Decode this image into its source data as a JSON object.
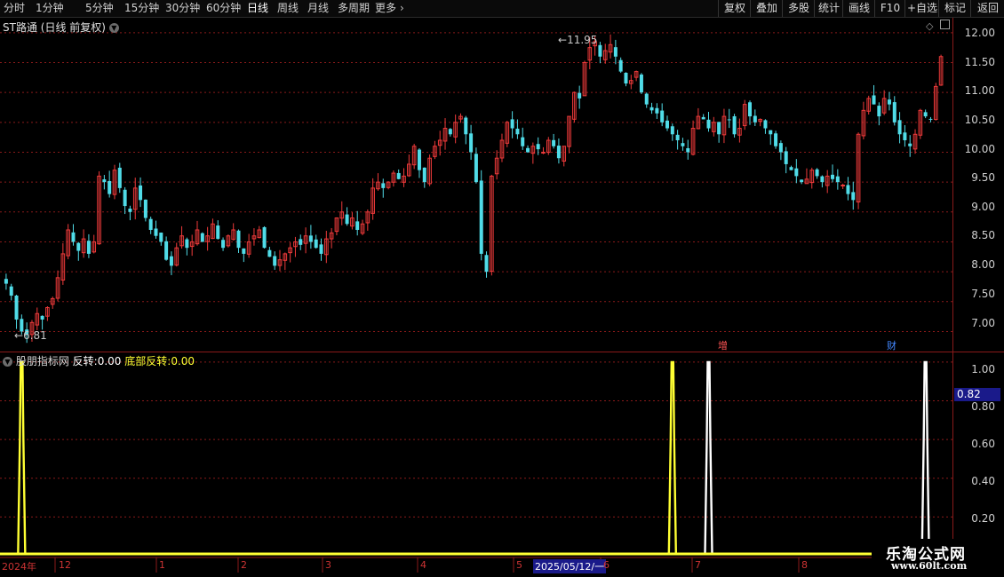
{
  "toolbar": {
    "periods": [
      "分时",
      "1分钟",
      "5分钟",
      "15分钟",
      "30分钟",
      "60分钟",
      "日线",
      "周线",
      "月线",
      "多周期",
      "更多"
    ],
    "active_period": "日线",
    "right_buttons": [
      "复权",
      "叠加",
      "多股",
      "统计",
      "画线",
      "F10",
      "+自选",
      "标记",
      "返回"
    ]
  },
  "main_panel": {
    "stock_title": "ST路通",
    "period_label": "(日线 前复权)",
    "high_label": "11.95",
    "low_label": "6.81",
    "markers": [
      {
        "text": "增",
        "color": "#ff5555"
      },
      {
        "text": "财",
        "color": "#4488ff"
      }
    ],
    "y_axis": [
      "12.00",
      "11.50",
      "11.00",
      "10.50",
      "10.00",
      "9.50",
      "9.00",
      "8.50",
      "8.00",
      "7.50",
      "7.00"
    ]
  },
  "sub_panel": {
    "indicator_name": "股朋指标网",
    "field1_label": "反转:",
    "field1_value": "0.00",
    "field2_label": "底部反转:",
    "field2_value": "0.00",
    "y_axis": [
      "1.00",
      "0.80",
      "0.60",
      "0.40",
      "0.20"
    ],
    "cursor_value": "0.82"
  },
  "date_axis": {
    "labels": [
      "2024年",
      "12",
      "1",
      "2",
      "3",
      "4",
      "5",
      "2025/05/12/一",
      "6",
      "7",
      "8"
    ]
  },
  "watermark": {
    "title": "乐淘公式网",
    "url": "www.60lt.com"
  },
  "colors": {
    "up": "#ee3a3a",
    "down": "#50dce8",
    "grid": "#8a1a1a",
    "signal_yellow": "#ffff33",
    "signal_white": "#ffffff",
    "cursor_box": "#1a1a8a"
  },
  "chart_data": [
    {
      "type": "candlestick",
      "y_axis_ticks": [
        7.0,
        7.5,
        8.0,
        8.5,
        9.0,
        9.5,
        10.0,
        10.5,
        11.0,
        11.5,
        12.0
      ],
      "ylim": [
        6.65,
        12.25
      ],
      "high": 11.95,
      "low": 6.81,
      "closes": [
        7.8,
        7.6,
        7.2,
        7.0,
        6.95,
        7.15,
        7.3,
        7.2,
        7.4,
        7.55,
        7.9,
        8.3,
        8.7,
        8.5,
        8.35,
        8.55,
        8.3,
        8.5,
        9.6,
        9.5,
        9.3,
        9.7,
        9.4,
        9.1,
        9.0,
        9.4,
        9.2,
        8.9,
        8.7,
        8.6,
        8.5,
        8.2,
        8.1,
        8.4,
        8.6,
        8.4,
        8.5,
        8.7,
        8.5,
        8.6,
        8.8,
        8.55,
        8.4,
        8.6,
        8.7,
        8.4,
        8.3,
        8.5,
        8.6,
        8.7,
        8.4,
        8.25,
        8.1,
        8.2,
        8.3,
        8.4,
        8.5,
        8.45,
        8.6,
        8.5,
        8.4,
        8.3,
        8.55,
        8.65,
        8.9,
        9.0,
        8.8,
        8.9,
        8.7,
        8.8,
        9.0,
        9.4,
        9.5,
        9.4,
        9.5,
        9.65,
        9.55,
        9.6,
        9.8,
        10.1,
        9.7,
        9.5,
        9.9,
        10.1,
        10.2,
        10.4,
        10.3,
        10.5,
        10.6,
        10.3,
        10.0,
        9.5,
        8.3,
        8.0,
        9.6,
        9.9,
        10.2,
        10.5,
        10.4,
        10.3,
        10.1,
        10.0,
        10.1,
        10.05,
        10.0,
        10.2,
        10.1,
        9.9,
        10.1,
        10.6,
        11.0,
        10.9,
        11.5,
        11.75,
        11.85,
        11.6,
        11.7,
        11.8,
        11.6,
        11.35,
        11.15,
        11.2,
        11.35,
        11.0,
        10.8,
        10.7,
        10.65,
        10.5,
        10.4,
        10.3,
        10.2,
        10.1,
        10.0,
        10.4,
        10.6,
        10.55,
        10.4,
        10.5,
        10.3,
        10.6,
        10.55,
        10.3,
        10.4,
        10.8,
        10.6,
        10.5,
        10.55,
        10.4,
        10.3,
        10.1,
        10.0,
        9.8,
        9.7,
        9.6,
        9.5,
        9.55,
        9.7,
        9.6,
        9.5,
        9.6,
        9.55,
        9.5,
        9.45,
        9.3,
        9.2,
        10.3,
        10.7,
        10.9,
        10.8,
        10.6,
        10.9,
        10.8,
        10.5,
        10.3,
        10.2,
        10.1,
        10.3,
        10.7,
        10.6,
        10.55,
        11.1,
        11.6
      ]
    },
    {
      "type": "line",
      "title": "股朋指标网",
      "y_axis_ticks": [
        0.2,
        0.4,
        0.6,
        0.8,
        1.0
      ],
      "ylim": [
        0.0,
        1.05
      ],
      "series": [
        {
          "name": "反转",
          "color": "#ffffff",
          "spikes_at_bar": [
            136,
            178
          ],
          "value": 1.0
        },
        {
          "name": "底部反转",
          "color": "#ffff33",
          "spikes_at_bar": [
            3,
            129
          ],
          "value": 1.0
        }
      ]
    }
  ]
}
